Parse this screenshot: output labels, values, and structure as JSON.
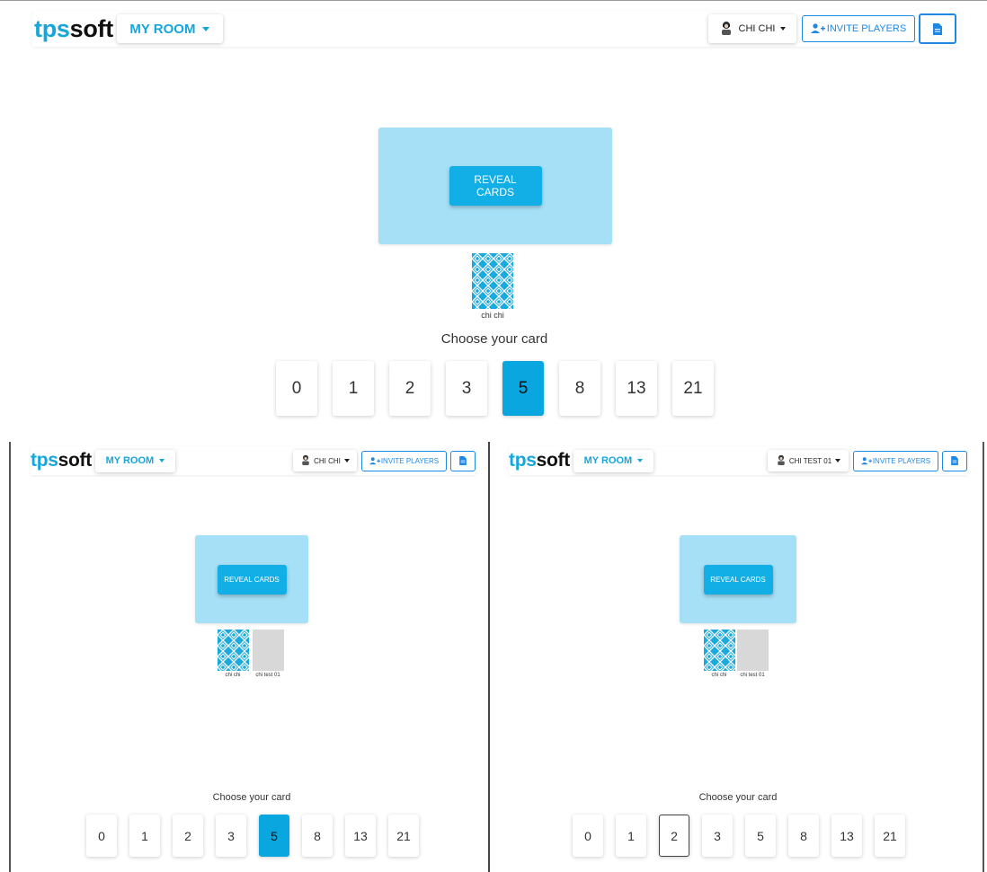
{
  "brand": {
    "prefix": "tps",
    "suffix": "soft"
  },
  "colors": {
    "accent": "#16a6da",
    "table": "#a6e0f6",
    "reveal": "#12aee6",
    "selected_card": "#0aa6e0",
    "invite_border": "#1e88e5"
  },
  "header": {
    "room_label": "MY ROOM",
    "invite_label": "INVITE PLAYERS",
    "icons": {
      "room_caret": "chevron-down-icon",
      "user_caret": "chevron-down-icon",
      "invite": "add-user-icon",
      "doc": "document-icon",
      "avatar": "avatar-icon"
    }
  },
  "windows": {
    "top": {
      "user_label": "CHI CHI",
      "reveal_label": "REVEAL CARDS",
      "players": [
        {
          "name": "chi chi",
          "state": "card-back"
        }
      ],
      "choose_label": "Choose your card",
      "cards": [
        "0",
        "1",
        "2",
        "3",
        "5",
        "8",
        "13",
        "21"
      ],
      "selected_card": "5"
    },
    "bottom_left": {
      "user_label": "CHI CHI",
      "reveal_label": "REVEAL CARDS",
      "players": [
        {
          "name": "chi chi",
          "state": "card-back"
        },
        {
          "name": "chi test 01",
          "state": "empty"
        }
      ],
      "choose_label": "Choose your card",
      "cards": [
        "0",
        "1",
        "2",
        "3",
        "5",
        "8",
        "13",
        "21"
      ],
      "selected_card": "5"
    },
    "bottom_right": {
      "user_label": "CHI TEST 01",
      "reveal_label": "REVEAL CARDS",
      "players": [
        {
          "name": "chi chi",
          "state": "card-back"
        },
        {
          "name": "chi test 01",
          "state": "empty"
        }
      ],
      "choose_label": "Choose your card",
      "cards": [
        "0",
        "1",
        "2",
        "3",
        "5",
        "8",
        "13",
        "21"
      ],
      "selected_card": "2"
    }
  }
}
